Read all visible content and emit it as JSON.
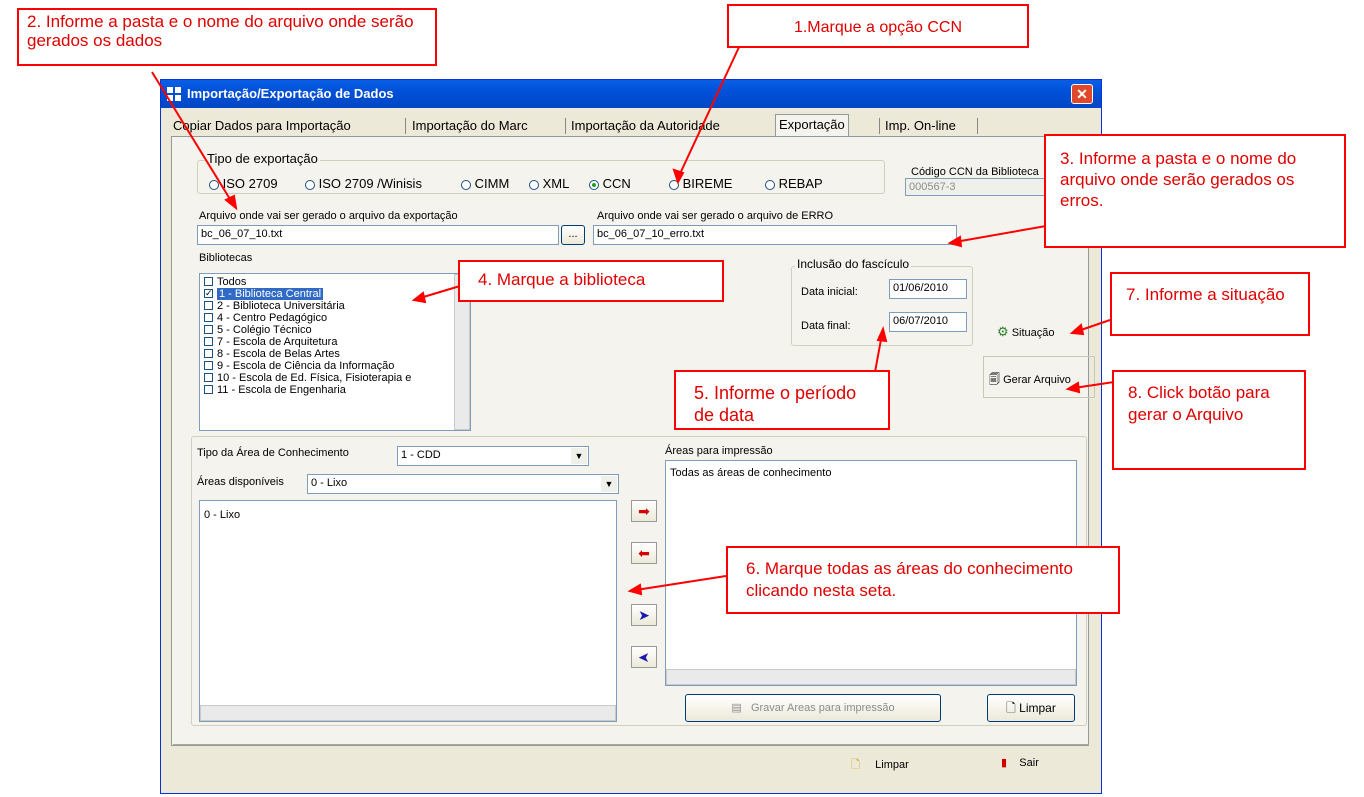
{
  "window": {
    "title": "Importação/Exportação de Dados",
    "close": "✕",
    "accent": "#0a5fe6"
  },
  "tabs": [
    {
      "label": "Copiar Dados para Importação"
    },
    {
      "label": "Importação do Marc"
    },
    {
      "label": "Importação da Autoridade"
    },
    {
      "label": "Exportação"
    },
    {
      "label": "Imp. On-line"
    }
  ],
  "export_type": {
    "legend": "Tipo de exportação",
    "options": [
      {
        "label": "ISO 2709",
        "selected": false
      },
      {
        "label": "ISO 2709 /Winisis",
        "selected": false
      },
      {
        "label": "CIMM",
        "selected": false
      },
      {
        "label": "XML",
        "selected": false
      },
      {
        "label": "CCN",
        "selected": true
      },
      {
        "label": "BIREME",
        "selected": false
      },
      {
        "label": "REBAP",
        "selected": false
      }
    ]
  },
  "ccn_code": {
    "label": "Código CCN da Biblioteca",
    "value": "000567-3"
  },
  "export_file": {
    "label": "Arquivo onde vai ser gerado o arquivo da exportação",
    "value": "bc_06_07_10.txt",
    "browse": "..."
  },
  "error_file": {
    "label": "Arquivo onde vai ser gerado o arquivo de ERRO",
    "value": "bc_06_07_10_erro.txt"
  },
  "libraries": {
    "label": "Bibliotecas",
    "items": [
      {
        "label": "Todos",
        "checked": false
      },
      {
        "label": "1 - Biblioteca Central",
        "checked": true
      },
      {
        "label": "2 - Biblioteca Universitária",
        "checked": false
      },
      {
        "label": "4 - Centro Pedagógico",
        "checked": false
      },
      {
        "label": "5 - Colégio Técnico",
        "checked": false
      },
      {
        "label": "7 - Escola de Arquitetura",
        "checked": false
      },
      {
        "label": "8 - Escola de Belas Artes",
        "checked": false
      },
      {
        "label": "9 - Escola de Ciência da Informação",
        "checked": false
      },
      {
        "label": "10 - Escola de Ed. Física, Fisioterapia e",
        "checked": false
      },
      {
        "label": "11 - Escola de Engenharia",
        "checked": false
      }
    ]
  },
  "fascicle": {
    "legend": "Inclusão do fascículo",
    "start_label": "Data inicial:",
    "start_value": "01/06/2010",
    "end_label": "Data final:",
    "end_value": "06/07/2010"
  },
  "buttons": {
    "situacao": "Situação",
    "gerar": "Gerar Arquivo",
    "gravar": "Gravar Areas para impressão",
    "limpar_areas": "Limpar",
    "limpar": "Limpar",
    "sair": "Sair"
  },
  "knowledge": {
    "type_label": "Tipo da Área de Conhecimento",
    "type_value": "1 - CDD",
    "available_label": "Áreas disponíveis",
    "available_value": "0 - Lixo",
    "available_items": [
      "0 - Lixo"
    ],
    "print_label": "Áreas para impressão",
    "print_items": [
      "Todas as áreas de conhecimento"
    ]
  },
  "callouts": {
    "c1": "1.Marque a opção CCN",
    "c2": "2. Informe a pasta e o nome do arquivo onde serão gerados os dados",
    "c3": "3. Informe a pasta e o nome do arquivo onde serão gerados os erros.",
    "c4": "4. Marque a biblioteca",
    "c5": "5. Informe o período de data",
    "c6": "6. Marque todas as áreas do conhecimento clicando nesta seta.",
    "c7": "7. Informe a situação",
    "c8": "8. Click botão para gerar o Arquivo"
  }
}
